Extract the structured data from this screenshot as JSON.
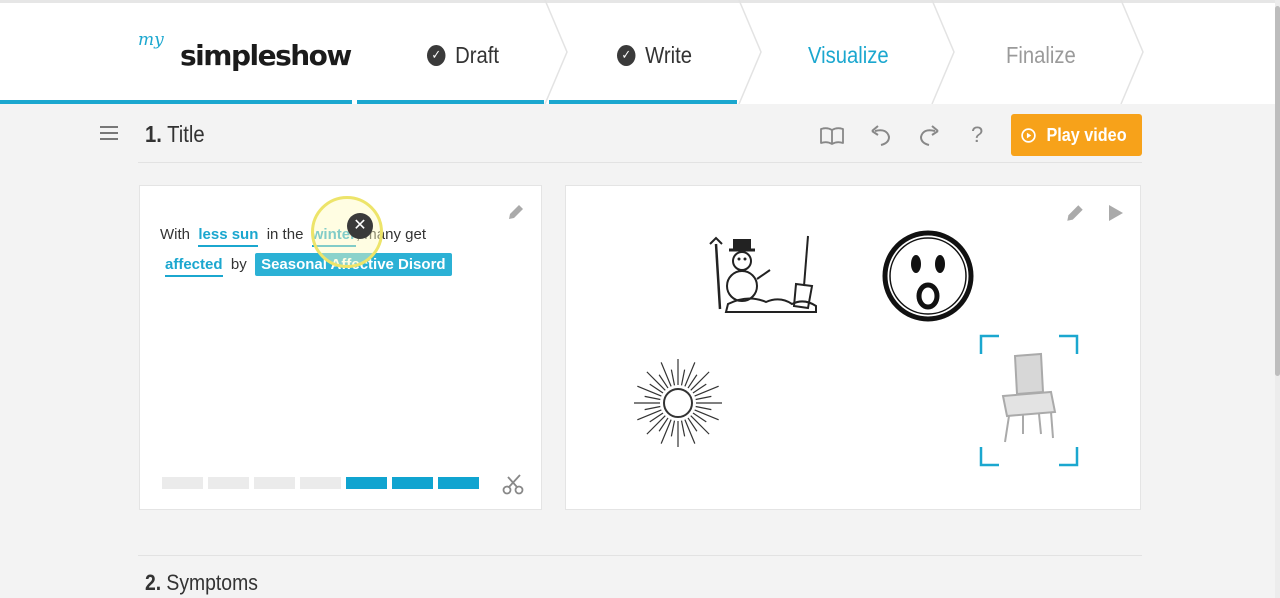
{
  "brand": {
    "logo_my": "my",
    "logo_main": "simpleshow"
  },
  "steps": {
    "draft": "Draft",
    "write": "Write",
    "visualize": "Visualize",
    "finalize": "Finalize"
  },
  "section1": {
    "number": "1.",
    "title": "Title"
  },
  "toolbar": {
    "help": "?",
    "play_label": "Play video"
  },
  "script_text": {
    "w1": "With",
    "k1": "less sun",
    "w2": "in the",
    "k2": "winter",
    "w3": ", many get",
    "k3": "affected",
    "w4": "by",
    "k4": "Seasonal Affective Disord"
  },
  "progress": {
    "segments_total": 7,
    "segments_active_from": 5
  },
  "colors": {
    "accent": "#1ba7cf",
    "play_button": "#f7a21a",
    "segment_on": "#10a4d0",
    "segment_off": "#ebebeb"
  },
  "icons": [
    "menu-icon",
    "book-icon",
    "undo-icon",
    "redo-icon",
    "help-icon",
    "play-circle-icon",
    "pencil-icon",
    "scissors-icon",
    "play-icon",
    "close-icon",
    "check-icon"
  ],
  "visuals": [
    "snowman-icon",
    "shocked-face-icon",
    "sun-icon",
    "chair-icon"
  ],
  "section2": {
    "number": "2.",
    "title": "Symptoms"
  }
}
